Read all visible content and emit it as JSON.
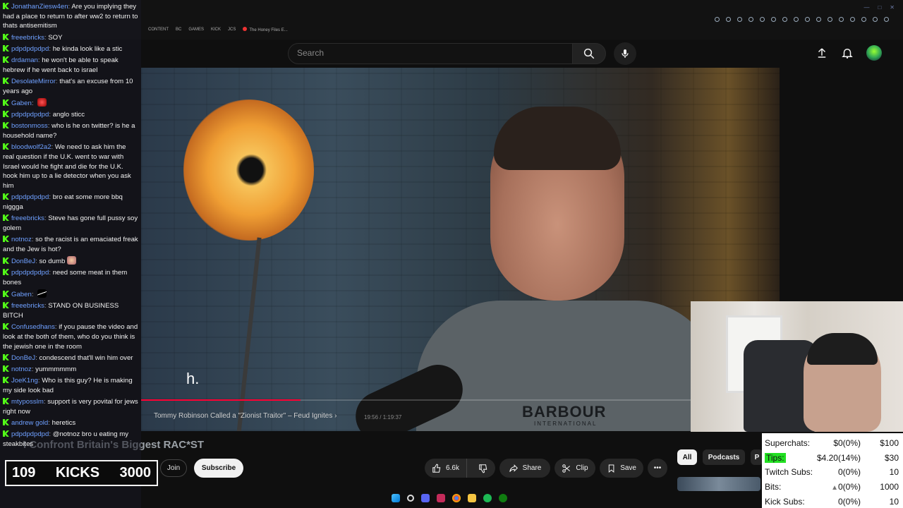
{
  "browser": {
    "tabs": [
      "CONTENT",
      "BC",
      "GAMES",
      "KICK",
      "JCS",
      "The Honey Files E..."
    ]
  },
  "youtube": {
    "search_placeholder": "Search",
    "video": {
      "subtitle_text": "h.",
      "endcard_title": "Tommy Robinson Called a \"Zionist Traitor\" – Feud Ignites",
      "shirt_brand": "BARBOUR",
      "shirt_brand_sub": "INTERNATIONAL",
      "timestamp": "19:56 / 1:19:37"
    },
    "title": "I Confront Britain's Biggest RAC*ST",
    "join_label": "Join",
    "subscribe_label": "Subscribe",
    "like_count": "6.6k",
    "share_label": "Share",
    "clip_label": "Clip",
    "save_label": "Save",
    "chips": [
      "All",
      "Podcasts",
      "P"
    ]
  },
  "chat": {
    "messages": [
      {
        "user": "JonathanZiesw4en",
        "text": "Are you implying they had a place to return to after ww2 to return to thats antisemitism",
        "emote": ""
      },
      {
        "user": "freeebricks",
        "text": "SOY",
        "emote": ""
      },
      {
        "user": "pdpdpdpdpd",
        "text": "he kinda look like a stic",
        "emote": ""
      },
      {
        "user": "drdaman",
        "text": "he won't be able to speak hebrew if he went back to israel",
        "emote": ""
      },
      {
        "user": "DesolateMirror",
        "text": "that's an excuse from 10 years ago",
        "emote": ""
      },
      {
        "user": "Gaben",
        "text": "",
        "emote": "red"
      },
      {
        "user": "pdpdpdpdpd",
        "text": "anglo sticc",
        "emote": ""
      },
      {
        "user": "bostonmoss",
        "text": "who is he on twitter? is he a household name?",
        "emote": ""
      },
      {
        "user": "bloodwolf2a2",
        "text": "We need to ask him the real question if the U.K. went to war with Israel would he fight and die for the U.K. hook him up to a lie detector when you ask him",
        "emote": ""
      },
      {
        "user": "pdpdpdpdpd",
        "text": "bro eat some more bbq niggga",
        "emote": ""
      },
      {
        "user": "freeebricks",
        "text": "Steve has gone full pussy soy golem",
        "emote": ""
      },
      {
        "user": "notnoz",
        "text": "so the racist is an emaciated freak and the Jew is hot?",
        "emote": ""
      },
      {
        "user": "DonBeJ",
        "text": "so dumb",
        "emote": "dog"
      },
      {
        "user": "pdpdpdpdpd",
        "text": "need some meat in them bones",
        "emote": ""
      },
      {
        "user": "Gaben",
        "text": "",
        "emote": "flag"
      },
      {
        "user": "freeebricks",
        "text": "STAND ON BUSINESS BITCH",
        "emote": ""
      },
      {
        "user": "Confusedhans",
        "text": "if you pause the video and look at the both of them, who do you think is the jewish one in the room",
        "emote": ""
      },
      {
        "user": "DonBeJ",
        "text": "condescend that'll win him over",
        "emote": ""
      },
      {
        "user": "notnoz",
        "text": "yummmmmm",
        "emote": ""
      },
      {
        "user": "JoeK1ng",
        "text": "Who is this guy? He is making my side look bad",
        "emote": ""
      },
      {
        "user": "mtyposslm",
        "text": "support is very povital for jews right now",
        "emote": ""
      },
      {
        "user": "andrew gold",
        "text": "heretics",
        "emote": ""
      },
      {
        "user": "pdpdpdpdpd",
        "text": "@notnoz bro u eating my steakbites",
        "emote": ""
      }
    ]
  },
  "kicks": {
    "count": "109",
    "label": "KICKS",
    "goal": "3000"
  },
  "stats": [
    {
      "label": "Superchats:",
      "value": "$0(0%)",
      "goal": "$100",
      "highlight": false
    },
    {
      "label": "Tips:",
      "value": "$4.20(14%)",
      "goal": "$30",
      "highlight": true
    },
    {
      "label": "Twitch Subs:",
      "value": "0(0%)",
      "goal": "10",
      "highlight": false
    },
    {
      "label": "Bits:",
      "value": "0(0%)",
      "goal": "1000",
      "highlight": false
    },
    {
      "label": "Kick Subs:",
      "value": "0(0%)",
      "goal": "10",
      "highlight": false
    }
  ],
  "colors": {
    "kick_green": "#53fc18",
    "chat_user_blue": "#6fa0ff",
    "tips_highlight": "#22e022",
    "youtube_red": "#ff0033"
  },
  "icons": {
    "search": "search-icon",
    "mic": "mic-icon",
    "upload": "upload-icon",
    "bell": "bell-icon",
    "like": "thumbs-up-icon",
    "dislike": "thumbs-down-icon",
    "share": "share-icon",
    "clip": "scissors-icon",
    "save": "bookmark-icon",
    "more": "more-icon"
  },
  "video_progress": 0.25
}
